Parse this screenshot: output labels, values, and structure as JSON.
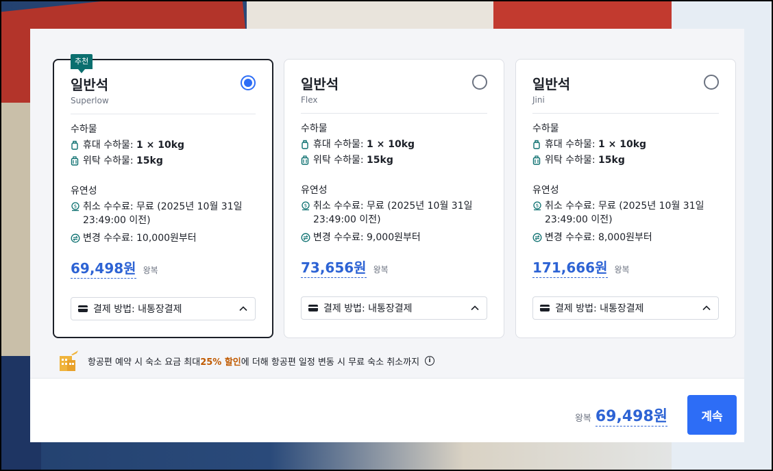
{
  "colors": {
    "accent": "#2d6df6",
    "price": "#2d63d4",
    "badge": "#0b6f6f",
    "highlight": "#c05a00"
  },
  "cards": [
    {
      "badge": "추천",
      "title": "일반석",
      "subtitle": "Superlow",
      "selected": true,
      "baggage_title": "수하물",
      "carry_on_label": "휴대 수하물: ",
      "carry_on_value": "1 × 10kg",
      "checked_label": "위탁 수하물: ",
      "checked_value": "15kg",
      "flex_title": "유연성",
      "cancel_fee": "취소 수수료: 무료 (2025년 10월 31일 23:49:00 이전)",
      "change_fee": "변경 수수료: 10,000원부터",
      "price": "69,498원",
      "price_unit": "왕복",
      "payment": "결제 방법: 내통장결제"
    },
    {
      "title": "일반석",
      "subtitle": "Flex",
      "selected": false,
      "baggage_title": "수하물",
      "carry_on_label": "휴대 수하물: ",
      "carry_on_value": "1 × 10kg",
      "checked_label": "위탁 수하물: ",
      "checked_value": "15kg",
      "flex_title": "유연성",
      "cancel_fee": "취소 수수료: 무료 (2025년 10월 31일 23:49:00 이전)",
      "change_fee": "변경 수수료: 9,000원부터",
      "price": "73,656원",
      "price_unit": "왕복",
      "payment": "결제 방법: 내통장결제"
    },
    {
      "title": "일반석",
      "subtitle": "Jini",
      "selected": false,
      "baggage_title": "수하물",
      "carry_on_label": "휴대 수하물: ",
      "carry_on_value": "1 × 10kg",
      "checked_label": "위탁 수하물: ",
      "checked_value": "15kg",
      "flex_title": "유연성",
      "cancel_fee": "취소 수수료: 무료 (2025년 10월 31일 23:49:00 이전)",
      "change_fee": "변경 수수료: 8,000원부터",
      "price": "171,666원",
      "price_unit": "왕복",
      "payment": "결제 방법: 내통장결제"
    }
  ],
  "promo": {
    "prefix": "항공편 예약 시 숙소 요금 최대 ",
    "highlight": "25% 할인",
    "suffix": "에 더해 항공편 일정 변동 시 무료 숙소 취소까지",
    "info_icon": "info-icon",
    "info_glyph": "i"
  },
  "footer": {
    "total_label": "왕복",
    "total_amount": "69,498원",
    "continue_label": "계속"
  }
}
